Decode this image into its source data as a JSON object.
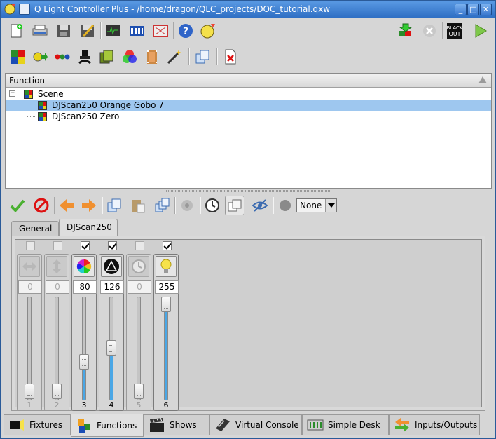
{
  "window": {
    "title": "Q Light Controller Plus - /home/dragon/QLC_projects/DOC_tutorial.qxw"
  },
  "function_tree": {
    "header": "Function",
    "root": "Scene",
    "items": [
      "DJScan250 Orange Gobo 7",
      "DJScan250 Zero"
    ],
    "selected_index": 0
  },
  "editor": {
    "mode_select": "None",
    "tabs": [
      "General",
      "DJScan250"
    ],
    "active_tab": 1
  },
  "channels": [
    {
      "number": "1",
      "value": "0",
      "enabled": false,
      "icon": "pan-icon"
    },
    {
      "number": "2",
      "value": "0",
      "enabled": false,
      "icon": "tilt-icon"
    },
    {
      "number": "3",
      "value": "80",
      "enabled": true,
      "icon": "color-wheel-icon"
    },
    {
      "number": "4",
      "value": "126",
      "enabled": true,
      "icon": "gobo-icon"
    },
    {
      "number": "5",
      "value": "0",
      "enabled": false,
      "icon": "speed-icon"
    },
    {
      "number": "6",
      "value": "255",
      "enabled": true,
      "icon": "intensity-icon"
    }
  ],
  "bottom_tabs": [
    {
      "label": "Fixtures",
      "icon": "fixtures-icon"
    },
    {
      "label": "Functions",
      "icon": "functions-icon"
    },
    {
      "label": "Shows",
      "icon": "shows-icon"
    },
    {
      "label": "Virtual Console",
      "icon": "virtual-console-icon"
    },
    {
      "label": "Simple Desk",
      "icon": "simple-desk-icon"
    },
    {
      "label": "Inputs/Outputs",
      "icon": "inputs-outputs-icon"
    }
  ],
  "active_bottom_tab": 1
}
